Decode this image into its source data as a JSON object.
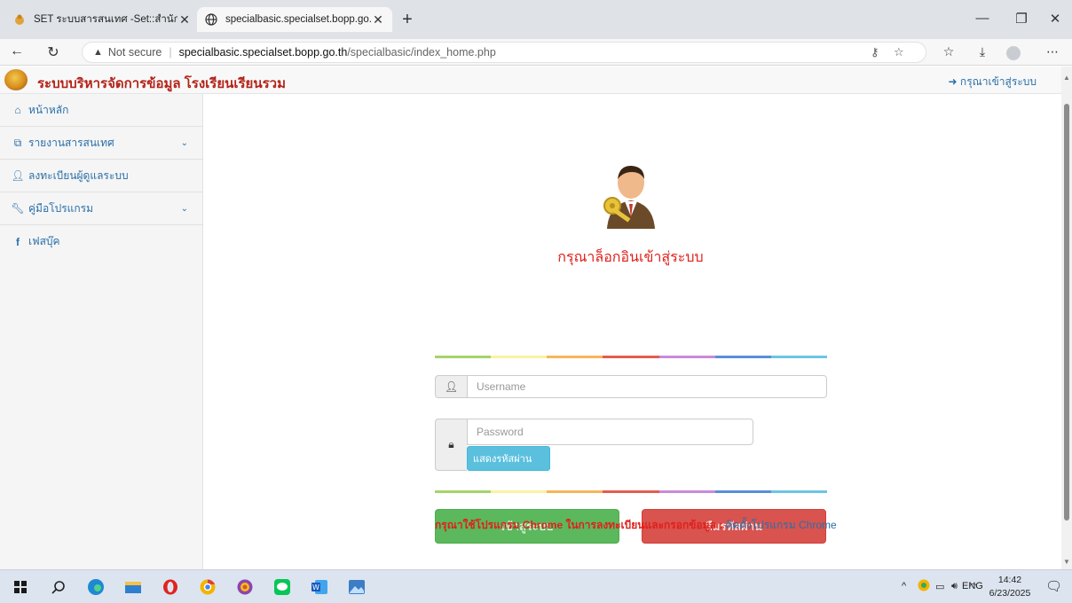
{
  "browser": {
    "tabs": [
      {
        "title": "SET ระบบสารสนเทศ -Set::สำนักบริหาร",
        "active": false
      },
      {
        "title": "specialbasic.specialset.bopp.go.th",
        "active": true
      }
    ],
    "security_label": "Not secure",
    "url_host": "specialbasic.specialset.bopp.go.th",
    "url_path": "/specialbasic/index_home.php"
  },
  "site": {
    "brand": "ระบบบริหารจัดการข้อมูล โรงเรียนเรียนรวม",
    "login_link": "กรุณาเข้าสู่ระบบ"
  },
  "sidebar": {
    "items": [
      {
        "label": "หน้าหลัก",
        "icon": "home-icon"
      },
      {
        "label": "รายงานสารสนเทศ",
        "icon": "copy-icon"
      },
      {
        "label": "ลงทะเบียนผู้ดูแลระบบ",
        "icon": "user-icon"
      },
      {
        "label": "คู่มือโปรแกรม",
        "icon": "wrench-icon"
      },
      {
        "label": "เฟสบุ๊ค",
        "icon": "facebook-icon"
      }
    ]
  },
  "login": {
    "title": "กรุณาล็อกอินเข้าสู่ระบบ",
    "username_placeholder": "Username",
    "password_placeholder": "Password",
    "show_password": "แสดงรหัสผ่าน",
    "submit": "เข้าสู่ระบบ",
    "forgot": "ลืมรหัสผ่าน",
    "notice_red": "กรุณาใช้โปรแกรม Chrome ในการลงทะเบียนและกรอกข้อมูล :",
    "notice_link": "ติดตั้งโปรแกรม Chrome"
  },
  "colors": {
    "brand_red": "#b32318",
    "link_blue": "#2a6fa8",
    "login_green": "#5cb85c",
    "forgot_red": "#d9534f",
    "info_blue": "#5bc0de",
    "rainbow": [
      "#a6d36a",
      "#fbf2a3",
      "#f7b55b",
      "#e35d4e",
      "#c98ad9",
      "#5a8fd8",
      "#6cc6e3"
    ]
  },
  "taskbar": {
    "language": "ENG",
    "time": "14:42",
    "date": "6/23/2025"
  }
}
